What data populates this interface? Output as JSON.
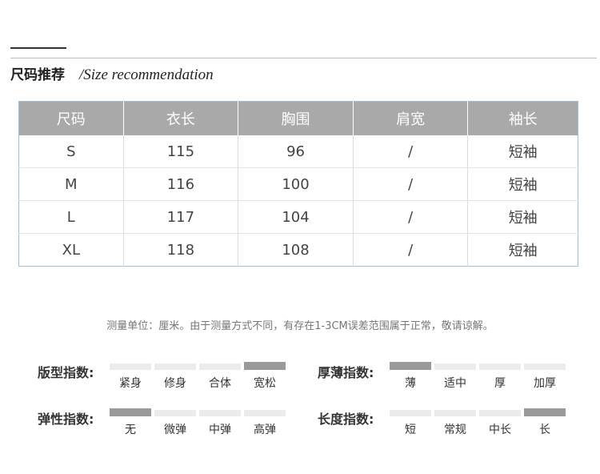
{
  "header": {
    "title_cn": "尺码推荐",
    "title_en": "/Size recommendation"
  },
  "table": {
    "headers": [
      "尺码",
      "衣长",
      "胸围",
      "肩宽",
      "袖长"
    ],
    "rows": [
      [
        "S",
        "115",
        "96",
        "/",
        "短袖"
      ],
      [
        "M",
        "116",
        "100",
        "/",
        "短袖"
      ],
      [
        "L",
        "117",
        "104",
        "/",
        "短袖"
      ],
      [
        "XL",
        "118",
        "108",
        "/",
        "短袖"
      ]
    ]
  },
  "note": "测量单位：厘米。由于测量方式不同，有存在1-3CM误差范围属于正常，敬请谅解。",
  "indices": {
    "fit": {
      "label": "版型指数:",
      "options": [
        "紧身",
        "修身",
        "合体",
        "宽松"
      ],
      "selected": 3
    },
    "thickness": {
      "label": "厚薄指数:",
      "options": [
        "薄",
        "适中",
        "厚",
        "加厚"
      ],
      "selected": 0
    },
    "elasticity": {
      "label": "弹性指数:",
      "options": [
        "无",
        "微弹",
        "中弹",
        "高弹"
      ],
      "selected": 0
    },
    "length": {
      "label": "长度指数:",
      "options": [
        "短",
        "常规",
        "中长",
        "长"
      ],
      "selected": 3
    }
  },
  "colors": {
    "header_bg": "#a9a9a9",
    "active_bar": "#9a9a9a",
    "inactive_bar": "#ececec",
    "table_border": "#9fc1d6"
  }
}
